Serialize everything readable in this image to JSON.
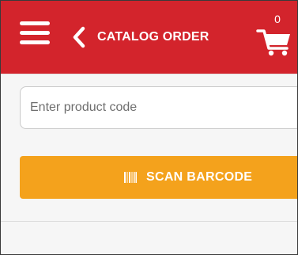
{
  "header": {
    "title": "CATALOG ORDER",
    "cart_count": "0",
    "menu_icon": "hamburger-menu-icon",
    "back_icon": "chevron-left-icon",
    "cart_icon": "shopping-cart-icon",
    "background_color": "#d3242c"
  },
  "product_code": {
    "placeholder": "Enter product code",
    "value": ""
  },
  "scan_button": {
    "label": "SCAN BARCODE",
    "icon": "barcode-icon",
    "color": "#f4a21c"
  }
}
